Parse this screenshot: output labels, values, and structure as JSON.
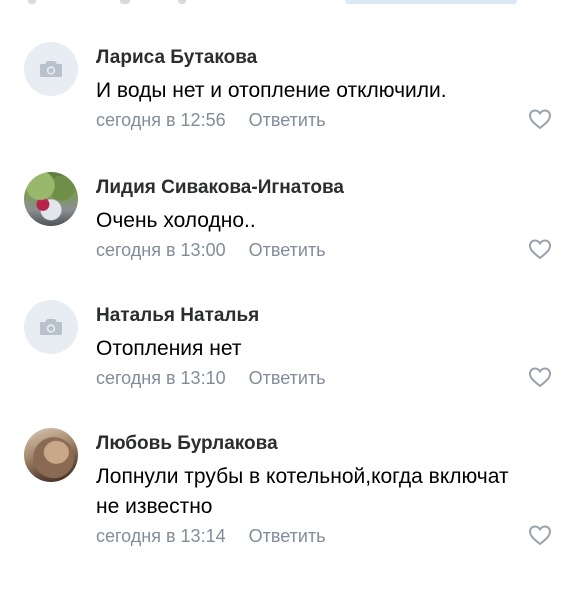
{
  "comments": [
    {
      "author": "Лариса Бутакова",
      "text": "И воды нет и отопление отключили.",
      "time": "сегодня в 12:56",
      "reply_label": "Ответить",
      "avatar": "camera-placeholder-icon"
    },
    {
      "author": "Лидия Сивакова-Игнатова",
      "text": "Очень холодно..",
      "time": "сегодня в 13:00",
      "reply_label": "Ответить",
      "avatar": "user-photo"
    },
    {
      "author": "Наталья Наталья",
      "text": "Отопления нет",
      "time": "сегодня в 13:10",
      "reply_label": "Ответить",
      "avatar": "camera-placeholder-icon"
    },
    {
      "author": "Любовь Бурлакова",
      "text": "Лопнули трубы в котельной,когда включат не известно",
      "time": "сегодня в 13:14",
      "reply_label": "Ответить",
      "avatar": "user-photo"
    }
  ],
  "icons": {
    "like": "heart-outline-icon",
    "avatar_placeholder": "camera-icon"
  },
  "colors": {
    "author": "#2c2d2e",
    "text": "#000000",
    "meta": "#818c99",
    "placeholder_bg": "#e8edf3",
    "placeholder_icon": "#b8c1cc",
    "like": "#99a2ad"
  }
}
